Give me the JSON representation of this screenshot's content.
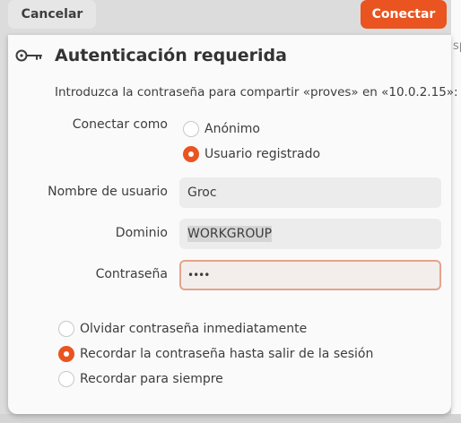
{
  "header": {
    "cancel_label": "Cancelar",
    "connect_label": "Conectar"
  },
  "dialog": {
    "title": "Autenticación requerida",
    "subtitle": "Introduzca la contraseña para compartir «proves» en «10.0.2.15»:",
    "connect_as_label": "Conectar como",
    "connect_as_options": [
      {
        "label": "Anónimo",
        "selected": false
      },
      {
        "label": "Usuario registrado",
        "selected": true
      }
    ],
    "username_label": "Nombre de usuario",
    "username_value": "Groc",
    "domain_label": "Dominio",
    "domain_value": "WORKGROUP",
    "password_label": "Contraseña",
    "password_value": "••••",
    "remember_options": [
      {
        "label": "Olvidar contraseña inmediatamente",
        "selected": false
      },
      {
        "label": "Recordar la contraseña hasta salir de la sesión",
        "selected": true
      },
      {
        "label": "Recordar para siempre",
        "selected": false
      }
    ]
  },
  "background": {
    "peek_text": "sp"
  },
  "colors": {
    "accent": "#e95420",
    "field_bg": "#ececec",
    "dialog_bg": "#fafafa"
  }
}
